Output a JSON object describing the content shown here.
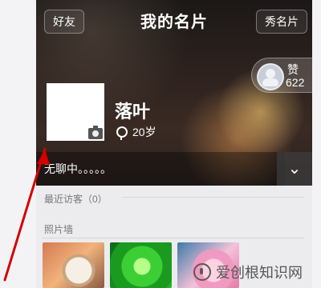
{
  "header": {
    "back_label": "好友",
    "title": "我的名片",
    "share_label": "秀名片"
  },
  "profile": {
    "name": "落叶",
    "age": "20岁",
    "status": "无聊中。。。。。"
  },
  "likes": {
    "label": "赞",
    "count": "622"
  },
  "sections": {
    "recent_visitors": "最近访客（0）",
    "photo_wall": "照片墙"
  },
  "watermark": {
    "text": "爱创根知识网"
  },
  "icons": {
    "back": "back-button",
    "expand": "chevron-down-icon",
    "camera": "camera-icon",
    "location": "location-pin-icon",
    "avatar": "avatar-icon"
  },
  "colors": {
    "accent_red": "#d40000"
  }
}
